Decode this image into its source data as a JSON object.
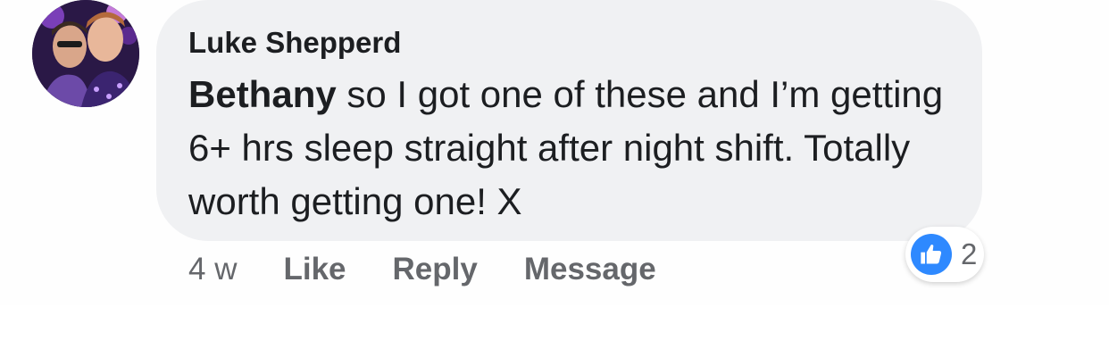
{
  "comment": {
    "author": "Luke Shepperd",
    "mention": "Bethany",
    "text": " so I got one of these and I’m getting 6+ hrs sleep straight after night shift. Totally worth getting one! X"
  },
  "actions": {
    "time": "4 w",
    "like_label": "Like",
    "reply_label": "Reply",
    "message_label": "Message"
  },
  "reactions": {
    "icon": "like-thumbs-up-icon",
    "count": "2",
    "color": "#2e89ff"
  },
  "colors": {
    "bubble": "#f0f1f3",
    "text": "#1c1e21",
    "muted": "#65676b"
  }
}
